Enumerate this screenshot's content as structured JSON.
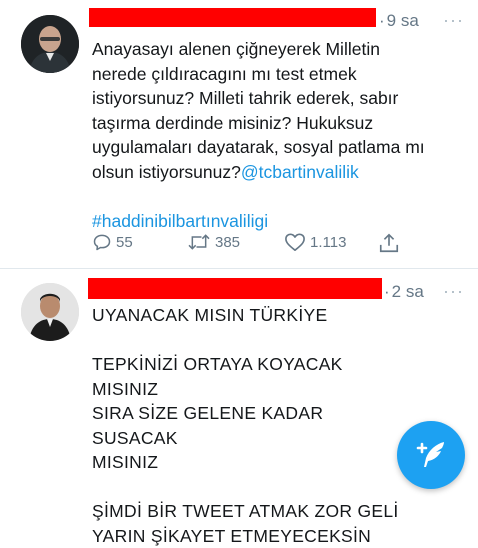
{
  "tweets": [
    {
      "time": "9 sa",
      "more": "···",
      "lines": [
        "Anayasayı alenen çiğneyerek Milletin",
        "nerede çıldıracagını mı test etmek",
        "istiyorsunuz? Milleti tahrik ederek, sabır",
        "taşırma derdinde misiniz? Hukuksuz",
        "uygulamaları dayatarak, sosyal patlama mı"
      ],
      "last_line_text": "olsun istiyorsunuz?",
      "mention": "@tcbartinvalilik",
      "hashtag": "#haddinibilbartınvaliligi",
      "actions": {
        "replies": "55",
        "retweets": "385",
        "likes": "1.113"
      }
    },
    {
      "time": "2 sa",
      "more": "···",
      "paragraphs": [
        "UYANACAK MISIN TÜRKİYE",
        "TEPKİNİZİ ORTAYA KOYACAK MISINIZ\nSIRA SİZE GELENE KADAR SUSACAK\nMISINIZ",
        "ŞİMDİ BİR TWEET ATMAK ZOR GELİ\nYARIN ŞİKAYET ETMEYECEKSİN"
      ]
    }
  ],
  "colors": {
    "link": "#1b95e0",
    "fab": "#1da1f2",
    "redaction": "#ff0000"
  },
  "icons": {
    "reply": "reply-icon",
    "retweet": "retweet-icon",
    "like": "heart-icon",
    "share": "share-icon",
    "more": "more-dots-icon",
    "compose": "compose-feather-icon"
  }
}
